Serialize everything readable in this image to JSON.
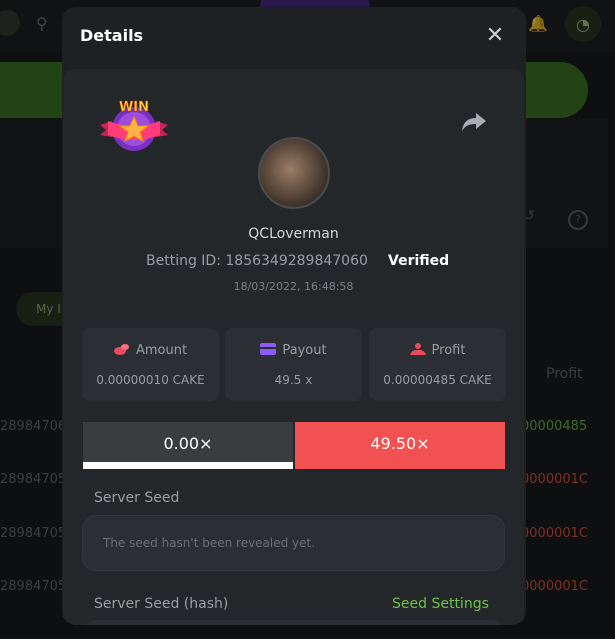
{
  "modal": {
    "title": "Details",
    "close_symbol": "✕",
    "share_icon": "share-icon",
    "badge": {
      "text": "WIN",
      "icon": "star-icon"
    },
    "user": {
      "username": "QCLoverman",
      "betting_id_label": "Betting ID:",
      "betting_id": "1856349289847060",
      "verified": "Verified",
      "timestamp": "18/03/2022, 16:48:58"
    },
    "stats": [
      {
        "label": "Amount",
        "value": "0.00000010 CAKE",
        "icon": "coins-icon",
        "color": "#e84a5f"
      },
      {
        "label": "Payout",
        "value": "49.5 x",
        "icon": "wallet-icon",
        "color": "#8b5cf6"
      },
      {
        "label": "Profit",
        "value": "0.00000485 CAKE",
        "icon": "profit-icon",
        "color": "#e84a5f"
      }
    ],
    "multipliers": {
      "left": "0.00×",
      "right": "49.50×"
    },
    "server_seed": {
      "label": "Server Seed",
      "placeholder": "The seed hasn't been revealed yet."
    },
    "server_seed_hash": {
      "label": "Server Seed (hash)",
      "settings_link": "Seed Settings"
    }
  },
  "background": {
    "my_bets_label": "My I",
    "profit_header": "Profit",
    "row_ids": [
      "28984706",
      "28984705",
      "28984705",
      "28984705"
    ],
    "row_profits": [
      "00000485",
      "0000001C",
      "0000001C",
      "0000001C"
    ],
    "colors": {
      "win": "#6cc24a",
      "loss": "#e8573a",
      "accent": "#f15151"
    }
  }
}
